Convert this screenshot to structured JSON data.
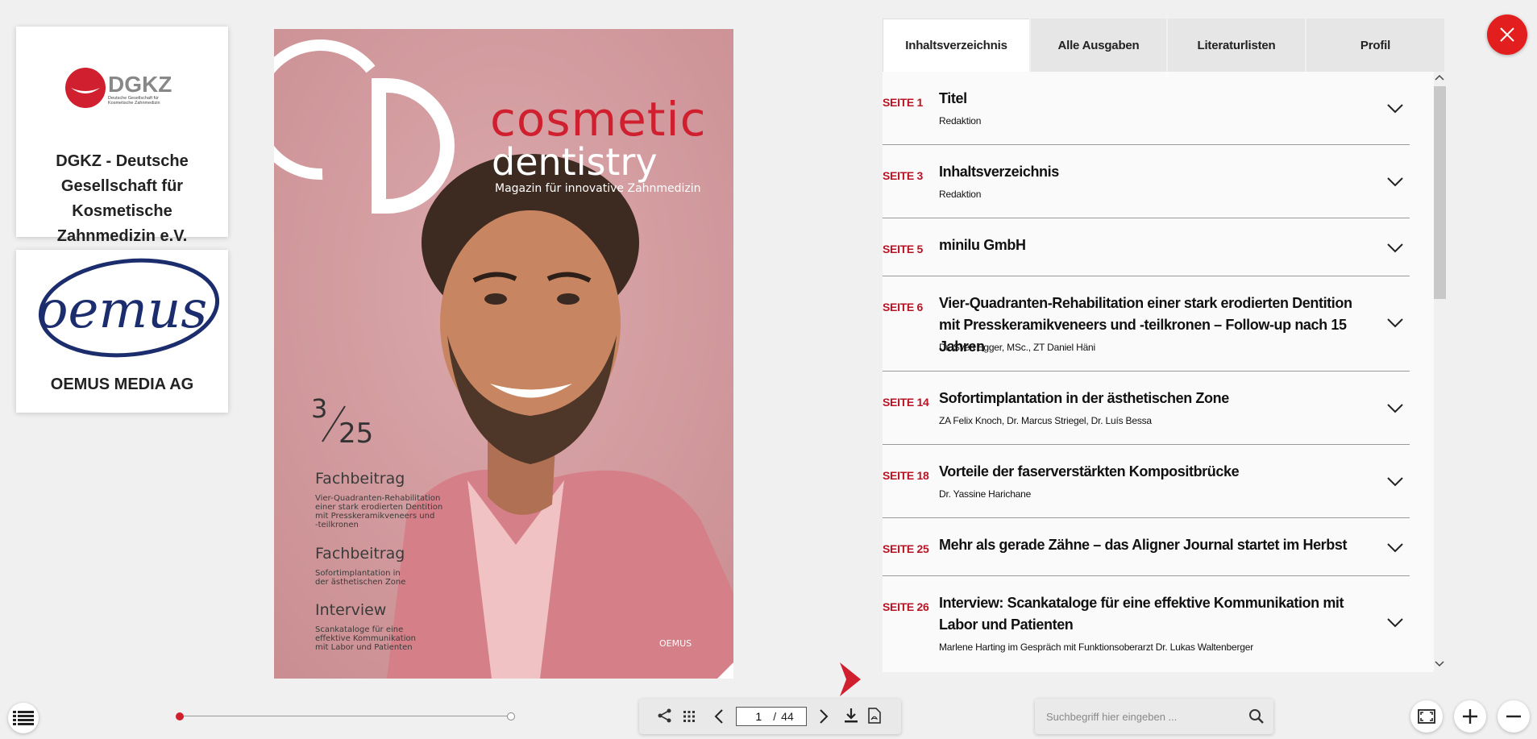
{
  "publishers": [
    {
      "name": "DGKZ - Deutsche Gesellschaft für Kosmetische Zahnmedizin e.V.",
      "logo_text": "DGKZ",
      "logo_sub": "Deutsche Gesellschaft für Kosmetische Zahnmedizin"
    },
    {
      "name": "OEMUS MEDIA AG",
      "logo_text": "oemus"
    }
  ],
  "cover": {
    "title_1": "cosmetic",
    "title_2": "dentistry",
    "subtitle": "Magazin für innovative Zahnmedizin",
    "issue_num": "3",
    "issue_year": "25",
    "sections": [
      {
        "heading": "Fachbeitrag",
        "lines": [
          "Vier-Quadranten-Rehabilitation",
          "einer stark erodierten Dentition",
          "mit Presskeramikveneers und",
          "-teilkronen"
        ]
      },
      {
        "heading": "Fachbeitrag",
        "lines": [
          "Sofortimplantation in",
          "der ästhetischen Zone"
        ]
      },
      {
        "heading": "Interview",
        "lines": [
          "Scankataloge für eine",
          "effektive Kommunikation",
          "mit Labor und Patienten"
        ]
      }
    ],
    "brand": "OEMUS"
  },
  "tabs": [
    {
      "label": "Inhaltsverzeichnis",
      "active": true
    },
    {
      "label": "Alle Ausgaben",
      "active": false
    },
    {
      "label": "Literaturlisten",
      "active": false
    },
    {
      "label": "Profil",
      "active": false
    }
  ],
  "toc": [
    {
      "page": "SEITE 1",
      "title": "Titel",
      "author": "Redaktion"
    },
    {
      "page": "SEITE 3",
      "title": "Inhaltsverzeichnis",
      "author": "Redaktion"
    },
    {
      "page": "SEITE 5",
      "title": "minilu GmbH",
      "author": ""
    },
    {
      "page": "SEITE 6",
      "title": "Vier-Quadranten-Rehabilitation einer stark erodierten Dentition mit Presskeramikveneers und -teilkronen – Follow-up nach 15 Jahren",
      "author": "Dr. Sven Egger, MSc., ZT Daniel Häni"
    },
    {
      "page": "SEITE 14",
      "title": "Sofortimplantation in der ästhetischen Zone",
      "author": "ZA Felix Knoch, Dr. Marcus Striegel, Dr. Luís Bessa"
    },
    {
      "page": "SEITE 18",
      "title": "Vorteile der faserverstärkten Kompositbrücke",
      "author": "Dr. Yassine Harichane"
    },
    {
      "page": "SEITE 25",
      "title": "Mehr als gerade Zähne – das Aligner Journal startet im Herbst",
      "author": ""
    },
    {
      "page": "SEITE 26",
      "title": "Interview: Scankataloge für eine effektive Kommunikation mit Labor und Patienten",
      "author": "Marlene Harting im Gespräch mit Funktionsoberarzt Dr. Lukas Waltenberger"
    }
  ],
  "pager": {
    "current": "1",
    "separator": "/",
    "total": "44"
  },
  "search": {
    "placeholder": "Suchbegriff hier eingeben ..."
  },
  "colors": {
    "accent": "#d01f2e",
    "page_label": "#b81424",
    "cover_bg": "#d29a9d"
  },
  "icons": [
    "close-icon",
    "list-icon",
    "share-icon",
    "grid-icon",
    "chevron-left-icon",
    "chevron-right-icon",
    "download-icon",
    "pdf-icon",
    "search-icon",
    "fullscreen-icon",
    "zoom-in-icon",
    "zoom-out-icon",
    "chevron-down-icon",
    "next-page-icon"
  ]
}
